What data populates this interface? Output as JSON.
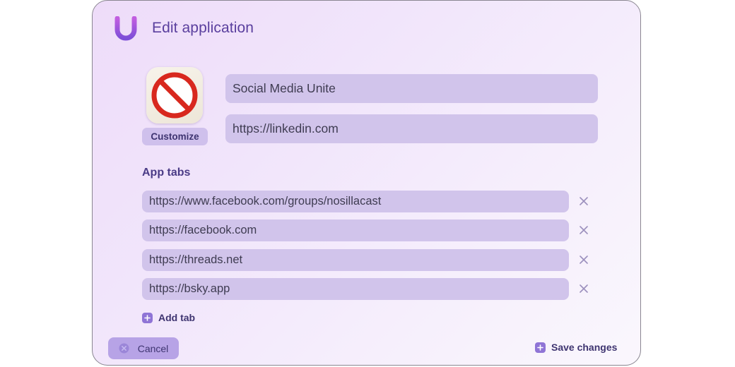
{
  "dialog": {
    "title": "Edit application",
    "logo_icon": "unite-u-logo-icon",
    "accent_color": "#8f74d6"
  },
  "app": {
    "icon": "prohibited-sign-icon",
    "customize_label": "Customize",
    "name_value": "Social Media Unite",
    "url_value": "https://linkedin.com"
  },
  "tabs_section": {
    "label": "App tabs",
    "tabs": [
      {
        "url": "https://www.facebook.com/groups/nosillacast",
        "remove_icon": "close-icon"
      },
      {
        "url": "https://facebook.com",
        "remove_icon": "close-icon"
      },
      {
        "url": "https://threads.net",
        "remove_icon": "close-icon"
      },
      {
        "url": "https://bsky.app",
        "remove_icon": "close-icon"
      }
    ],
    "add_tab_label": "Add tab"
  },
  "footer": {
    "cancel_label": "Cancel",
    "save_label": "Save changes"
  }
}
